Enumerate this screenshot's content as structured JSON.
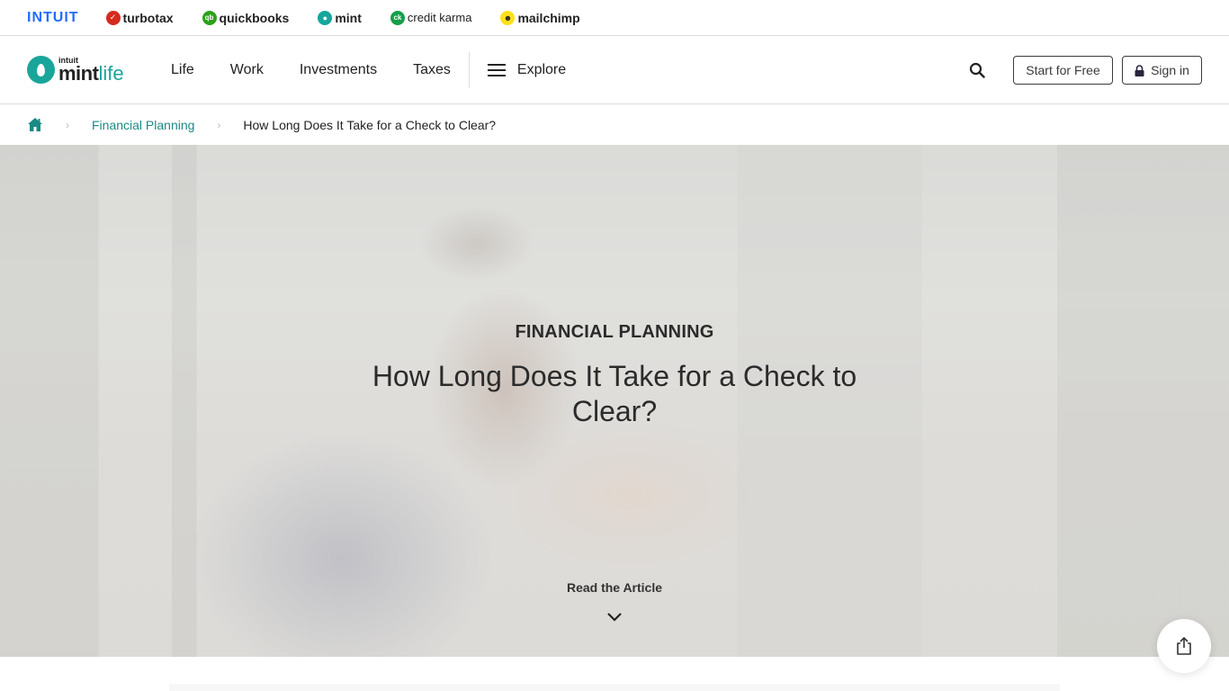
{
  "brand_bar": {
    "brands": [
      {
        "name": "INTUIT",
        "icon": "intuit-wordmark"
      },
      {
        "name": "turbotax",
        "icon": "turbotax-check-icon"
      },
      {
        "name": "quickbooks",
        "icon": "quickbooks-qb-icon"
      },
      {
        "name": "mint",
        "icon": "mint-drop-icon"
      },
      {
        "name": "credit karma",
        "icon": "credit-karma-ck-icon"
      },
      {
        "name": "mailchimp",
        "icon": "mailchimp-freddie-icon"
      }
    ],
    "icon_glyphs": {
      "quickbooks": "qb",
      "creditkarma": "ck"
    }
  },
  "header": {
    "logo": {
      "top": "intuit",
      "main": "mint",
      "accent": "life"
    },
    "nav_links": [
      "Life",
      "Work",
      "Investments",
      "Taxes"
    ],
    "explore_label": "Explore",
    "start_button": "Start for Free",
    "signin_button": "Sign in"
  },
  "breadcrumb": {
    "home_icon": "home-icon",
    "items": [
      "Financial Planning",
      "How Long Does It Take for a Check to Clear?"
    ],
    "separator": "›"
  },
  "hero": {
    "category": "FINANCIAL PLANNING",
    "title": "How Long Does It Take for a Check to Clear?",
    "cta": "Read the Article"
  },
  "colors": {
    "accent_teal": "#1aa59b",
    "breadcrumb_link": "#1a8a84",
    "intuit_blue": "#236cff",
    "text_dark": "#222222"
  }
}
